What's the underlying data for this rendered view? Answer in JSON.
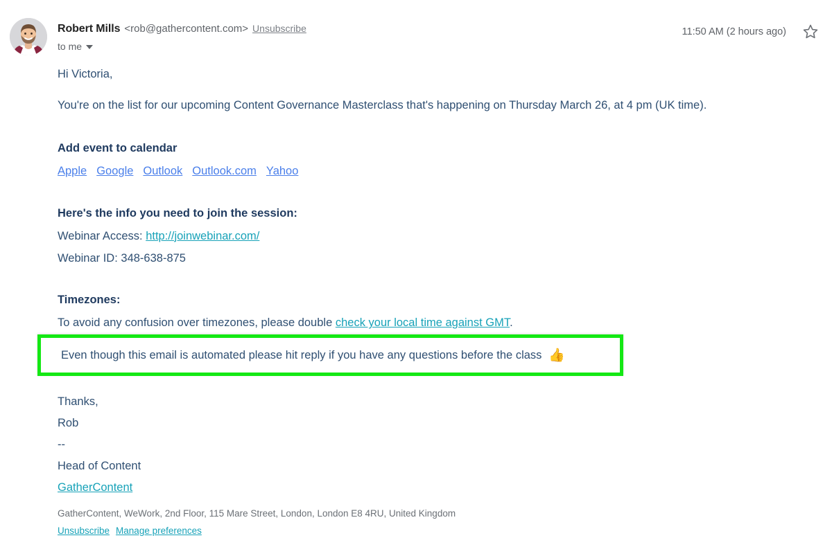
{
  "header": {
    "sender_name": "Robert Mills",
    "sender_email": "<rob@gathercontent.com>",
    "unsubscribe_label": "Unsubscribe",
    "recipient_label": "to me",
    "timestamp": "11:50 AM (2 hours ago)",
    "star_icon": "star-outline-icon",
    "avatar_alt": "avatar"
  },
  "body": {
    "greeting": "Hi Victoria,",
    "intro": "You're on the list for our upcoming Content Governance Masterclass that's happening on Thursday March 26, at 4 pm (UK time).",
    "calendar": {
      "heading": "Add event to calendar",
      "links": [
        "Apple",
        "Google",
        "Outlook",
        "Outlook.com",
        "Yahoo"
      ]
    },
    "join_info": {
      "heading": "Here's the info you need to join the session:",
      "access_label": "Webinar Access:",
      "access_url": "http://joinwebinar.com/",
      "id_line": "Webinar ID: 348-638-875"
    },
    "timezones": {
      "heading": "Timezones:",
      "text_before": "To avoid any confusion over timezones, please double",
      "link": "check your local time against GMT",
      "text_after": "."
    },
    "callout": {
      "text": "Even though this email is automated please hit reply if you have any questions before the class",
      "emoji": "👍"
    },
    "signature": {
      "closing": "Thanks,",
      "name": "Rob",
      "separator": "--",
      "title": "Head of Content",
      "company_link": "GatherContent"
    }
  },
  "footer": {
    "address": "GatherContent, WeWork, 2nd Floor, 115 Mare Street, London, London E8 4RU, United Kingdom",
    "unsubscribe_label": "Unsubscribe",
    "manage_label": "Manage preferences"
  },
  "colors": {
    "body_text": "#2f4f72",
    "heading_text": "#1f3a5f",
    "calendar_link": "#4a7fea",
    "teal_link": "#17a2b8",
    "highlight_border": "#14e814",
    "muted_text": "#5f6368"
  }
}
